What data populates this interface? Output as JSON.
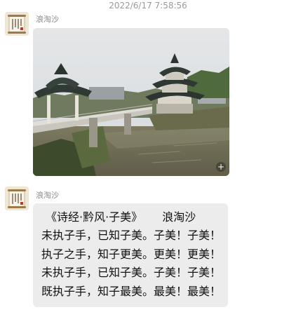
{
  "timestamp": "2022/6/17 7:58:56",
  "messages": [
    {
      "sender": "浪淘沙",
      "type": "image",
      "avatar_icon": "scroll-calligraphy-avatar",
      "expand_icon": "plus-icon",
      "expand_symbol": "+"
    },
    {
      "sender": "浪淘沙",
      "type": "text",
      "avatar_icon": "scroll-calligraphy-avatar",
      "poem": {
        "title": "《诗经·黔风·子美》",
        "author": "浪淘沙",
        "lines": [
          "未执子手，已知子美。子美！子美！",
          "执子之手，知子更美。更美！更美！",
          "未执子手，已知子美。子美！子美！",
          "既执子手，知子最美。最美！最美！"
        ]
      }
    }
  ],
  "colors": {
    "bubble_background": "#ececec",
    "timestamp_text": "#9a9a9a",
    "sender_text": "#8a8a8a"
  }
}
